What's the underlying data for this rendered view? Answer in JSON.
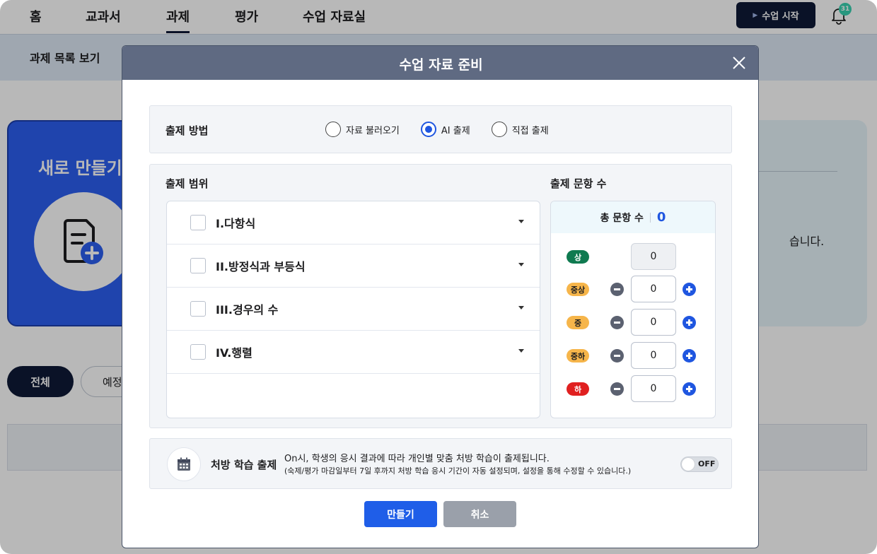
{
  "nav": {
    "items": [
      {
        "label": "홈"
      },
      {
        "label": "교과서"
      },
      {
        "label": "과제"
      },
      {
        "label": "평가"
      },
      {
        "label": "수업 자료실"
      }
    ],
    "active_index": 2,
    "start_button": "수업 시작",
    "notification_count": "31"
  },
  "subbar": {
    "title": "과제 목록 보기"
  },
  "background": {
    "new_card_title": "새로 만들기",
    "right_card_text": "습니다.",
    "filter_all": "전체",
    "filter_other": "예정"
  },
  "modal": {
    "title": "수업 자료 준비",
    "method": {
      "label": "출제 방법",
      "options": [
        {
          "label": "자료 불러오기",
          "checked": false
        },
        {
          "label": "AI 출제",
          "checked": true
        },
        {
          "label": "직접 출제",
          "checked": false
        }
      ]
    },
    "range": {
      "label": "출제 범위",
      "items": [
        {
          "label": "I.다항식",
          "checked": false
        },
        {
          "label": "II.방정식과 부등식",
          "checked": false
        },
        {
          "label": "III.경우의 수",
          "checked": false
        },
        {
          "label": "IV.행렬",
          "checked": false
        }
      ]
    },
    "count": {
      "label": "출제 문항 수",
      "total_label": "총 문항 수",
      "total_value": "0",
      "levels": [
        {
          "label": "상",
          "value": "0",
          "color": "#0f7a50",
          "text_color": "#ffffff",
          "adjustable": false
        },
        {
          "label": "중상",
          "value": "0",
          "color": "#f6b54a",
          "text_color": "#1d1d1f",
          "adjustable": true
        },
        {
          "label": "중",
          "value": "0",
          "color": "#f6b54a",
          "text_color": "#1d1d1f",
          "adjustable": true
        },
        {
          "label": "중하",
          "value": "0",
          "color": "#f6b54a",
          "text_color": "#1d1d1f",
          "adjustable": true
        },
        {
          "label": "하",
          "value": "0",
          "color": "#e02020",
          "text_color": "#ffffff",
          "adjustable": true
        }
      ]
    },
    "prescription": {
      "title": "처방 학습 출제",
      "description": "On시, 학생의 응시 결과에 따라 개인별 맞춤 처방 학습이 출제됩니다.",
      "note": "(숙제/평가 마감일부터 7일 후까지 처방 학습 응시 기간이 자동 설정되며, 설정을 통해 수정할 수 있습니다.)",
      "toggle_label": "OFF"
    },
    "buttons": {
      "create": "만들기",
      "cancel": "취소"
    }
  },
  "colors": {
    "accent": "#1f56e0",
    "header": "#5f6a82",
    "dark_navy": "#0e1a36"
  }
}
